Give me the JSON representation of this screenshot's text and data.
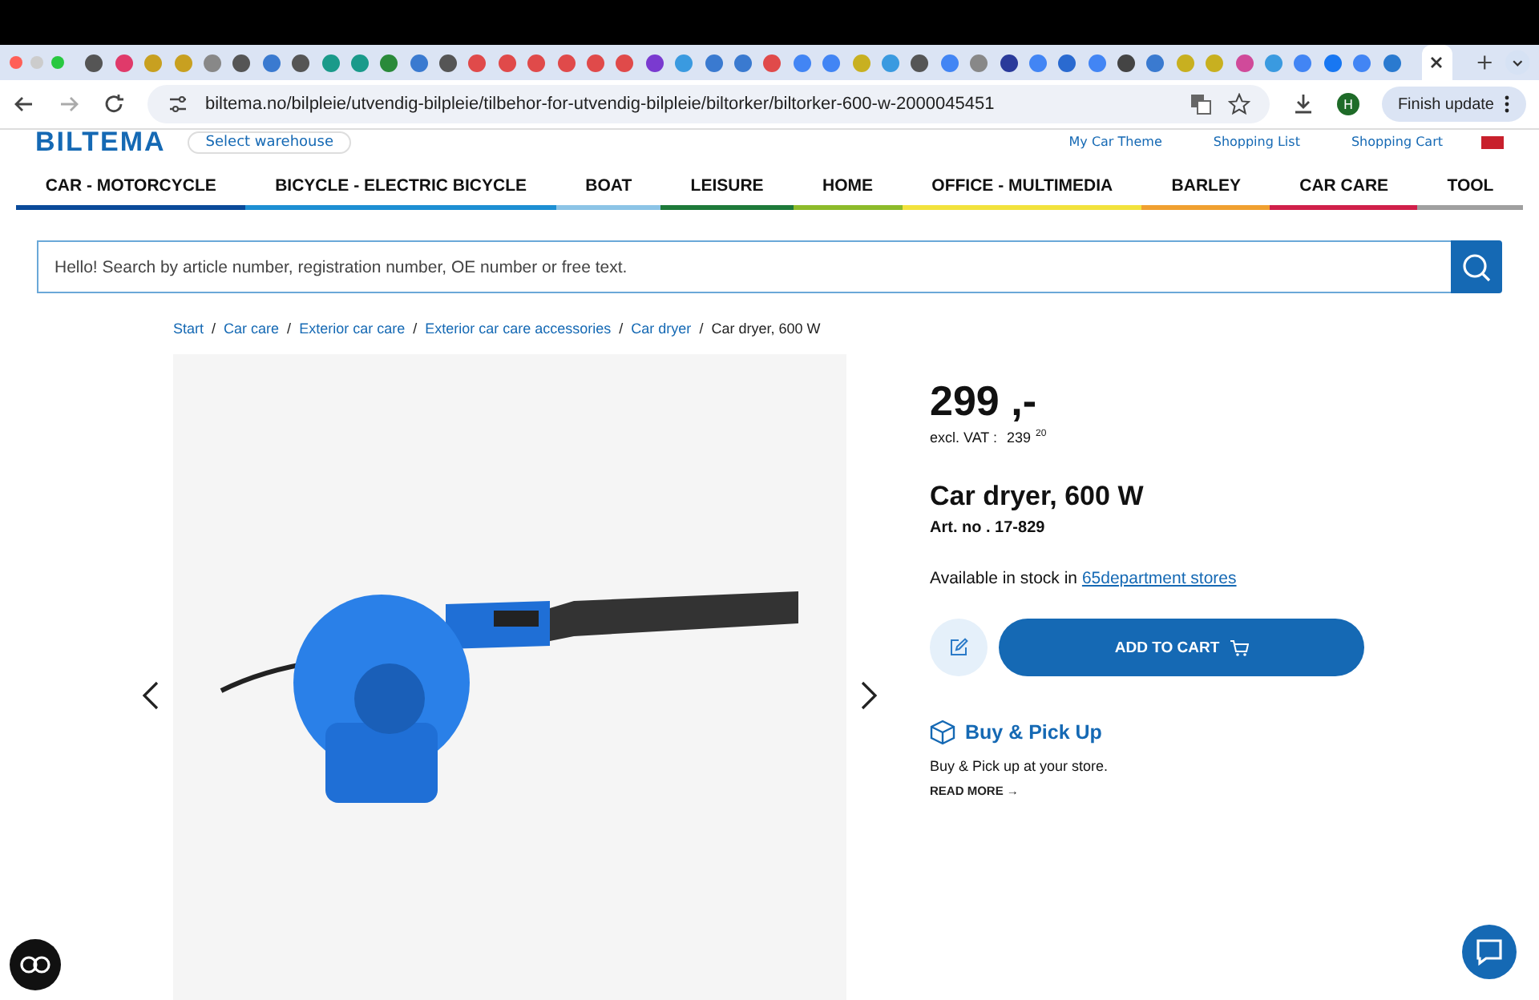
{
  "browser": {
    "url": "biltema.no/bilpleie/utvendig-bilpleie/tilbehor-for-utvendig-bilpleie/biltorker/biltorker-600-w-2000045451",
    "profile_initial": "H",
    "update_button": "Finish update"
  },
  "header": {
    "logo": "BILTEMA",
    "warehouse": "Select warehouse",
    "links": [
      "My Car Theme",
      "Shopping List",
      "Shopping Cart"
    ]
  },
  "nav": [
    {
      "label": "CAR - MOTORCYCLE",
      "color": "#0a4a9a"
    },
    {
      "label": "BICYCLE - ELECTRIC BICYCLE",
      "color": "#1d8fd3"
    },
    {
      "label": "BOAT",
      "color": "#8cc4e6"
    },
    {
      "label": "LEISURE",
      "color": "#1e7a3a"
    },
    {
      "label": "HOME",
      "color": "#8dbb2a"
    },
    {
      "label": "OFFICE - MULTIMEDIA",
      "color": "#f2e23c"
    },
    {
      "label": "BARLEY",
      "color": "#f0a030"
    },
    {
      "label": "CAR CARE",
      "color": "#d0204a"
    },
    {
      "label": "TOOL",
      "color": "#a0a0a0"
    }
  ],
  "search": {
    "placeholder": "Hello! Search by article number, registration number, OE number or free text."
  },
  "breadcrumb_separator": "/",
  "breadcrumb": [
    "Start",
    "Car care",
    "Exterior car care",
    "Exterior car care accessories",
    "Car dryer",
    "Car dryer, 600 W"
  ],
  "product": {
    "price": "299 ,-",
    "vat_label": "excl. VAT :",
    "vat_price": "239",
    "vat_cents": "20",
    "name": "Car dryer, 600 W",
    "art_no": "Art. no . 17-829",
    "stock_text": "Available in stock in",
    "stock_link": "65department stores",
    "add_to_cart": "ADD TO CART",
    "pickup_title": "Buy & Pick Up",
    "pickup_text": "Buy & Pick up at your store.",
    "read_more": "READ MORE →"
  }
}
